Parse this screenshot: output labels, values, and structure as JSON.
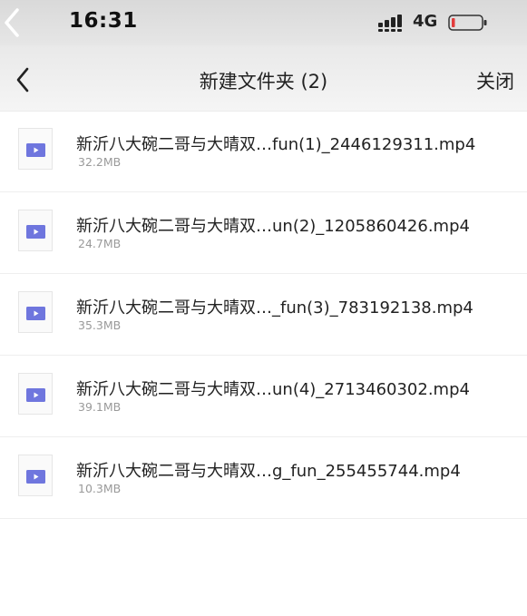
{
  "status_bar": {
    "time": "16:31",
    "network": "4G"
  },
  "nav": {
    "title": "新建文件夹 (2)",
    "close_label": "关闭"
  },
  "files": [
    {
      "name": "新沂八大碗二哥与大晴双…fun(1)_2446129311.mp4",
      "size": "32.2MB"
    },
    {
      "name": "新沂八大碗二哥与大晴双…un(2)_1205860426.mp4",
      "size": "24.7MB"
    },
    {
      "name": "新沂八大碗二哥与大晴双…_fun(3)_783192138.mp4",
      "size": "35.3MB"
    },
    {
      "name": "新沂八大碗二哥与大晴双…un(4)_2713460302.mp4",
      "size": "39.1MB"
    },
    {
      "name": "新沂八大碗二哥与大晴双…g_fun_255455744.mp4",
      "size": "10.3MB"
    }
  ],
  "colors": {
    "thumb_icon": "#6f76de",
    "battery_low": "#e23b3b"
  },
  "icons": {
    "file_type": "video-file-icon",
    "back": "chevron-left-icon"
  }
}
